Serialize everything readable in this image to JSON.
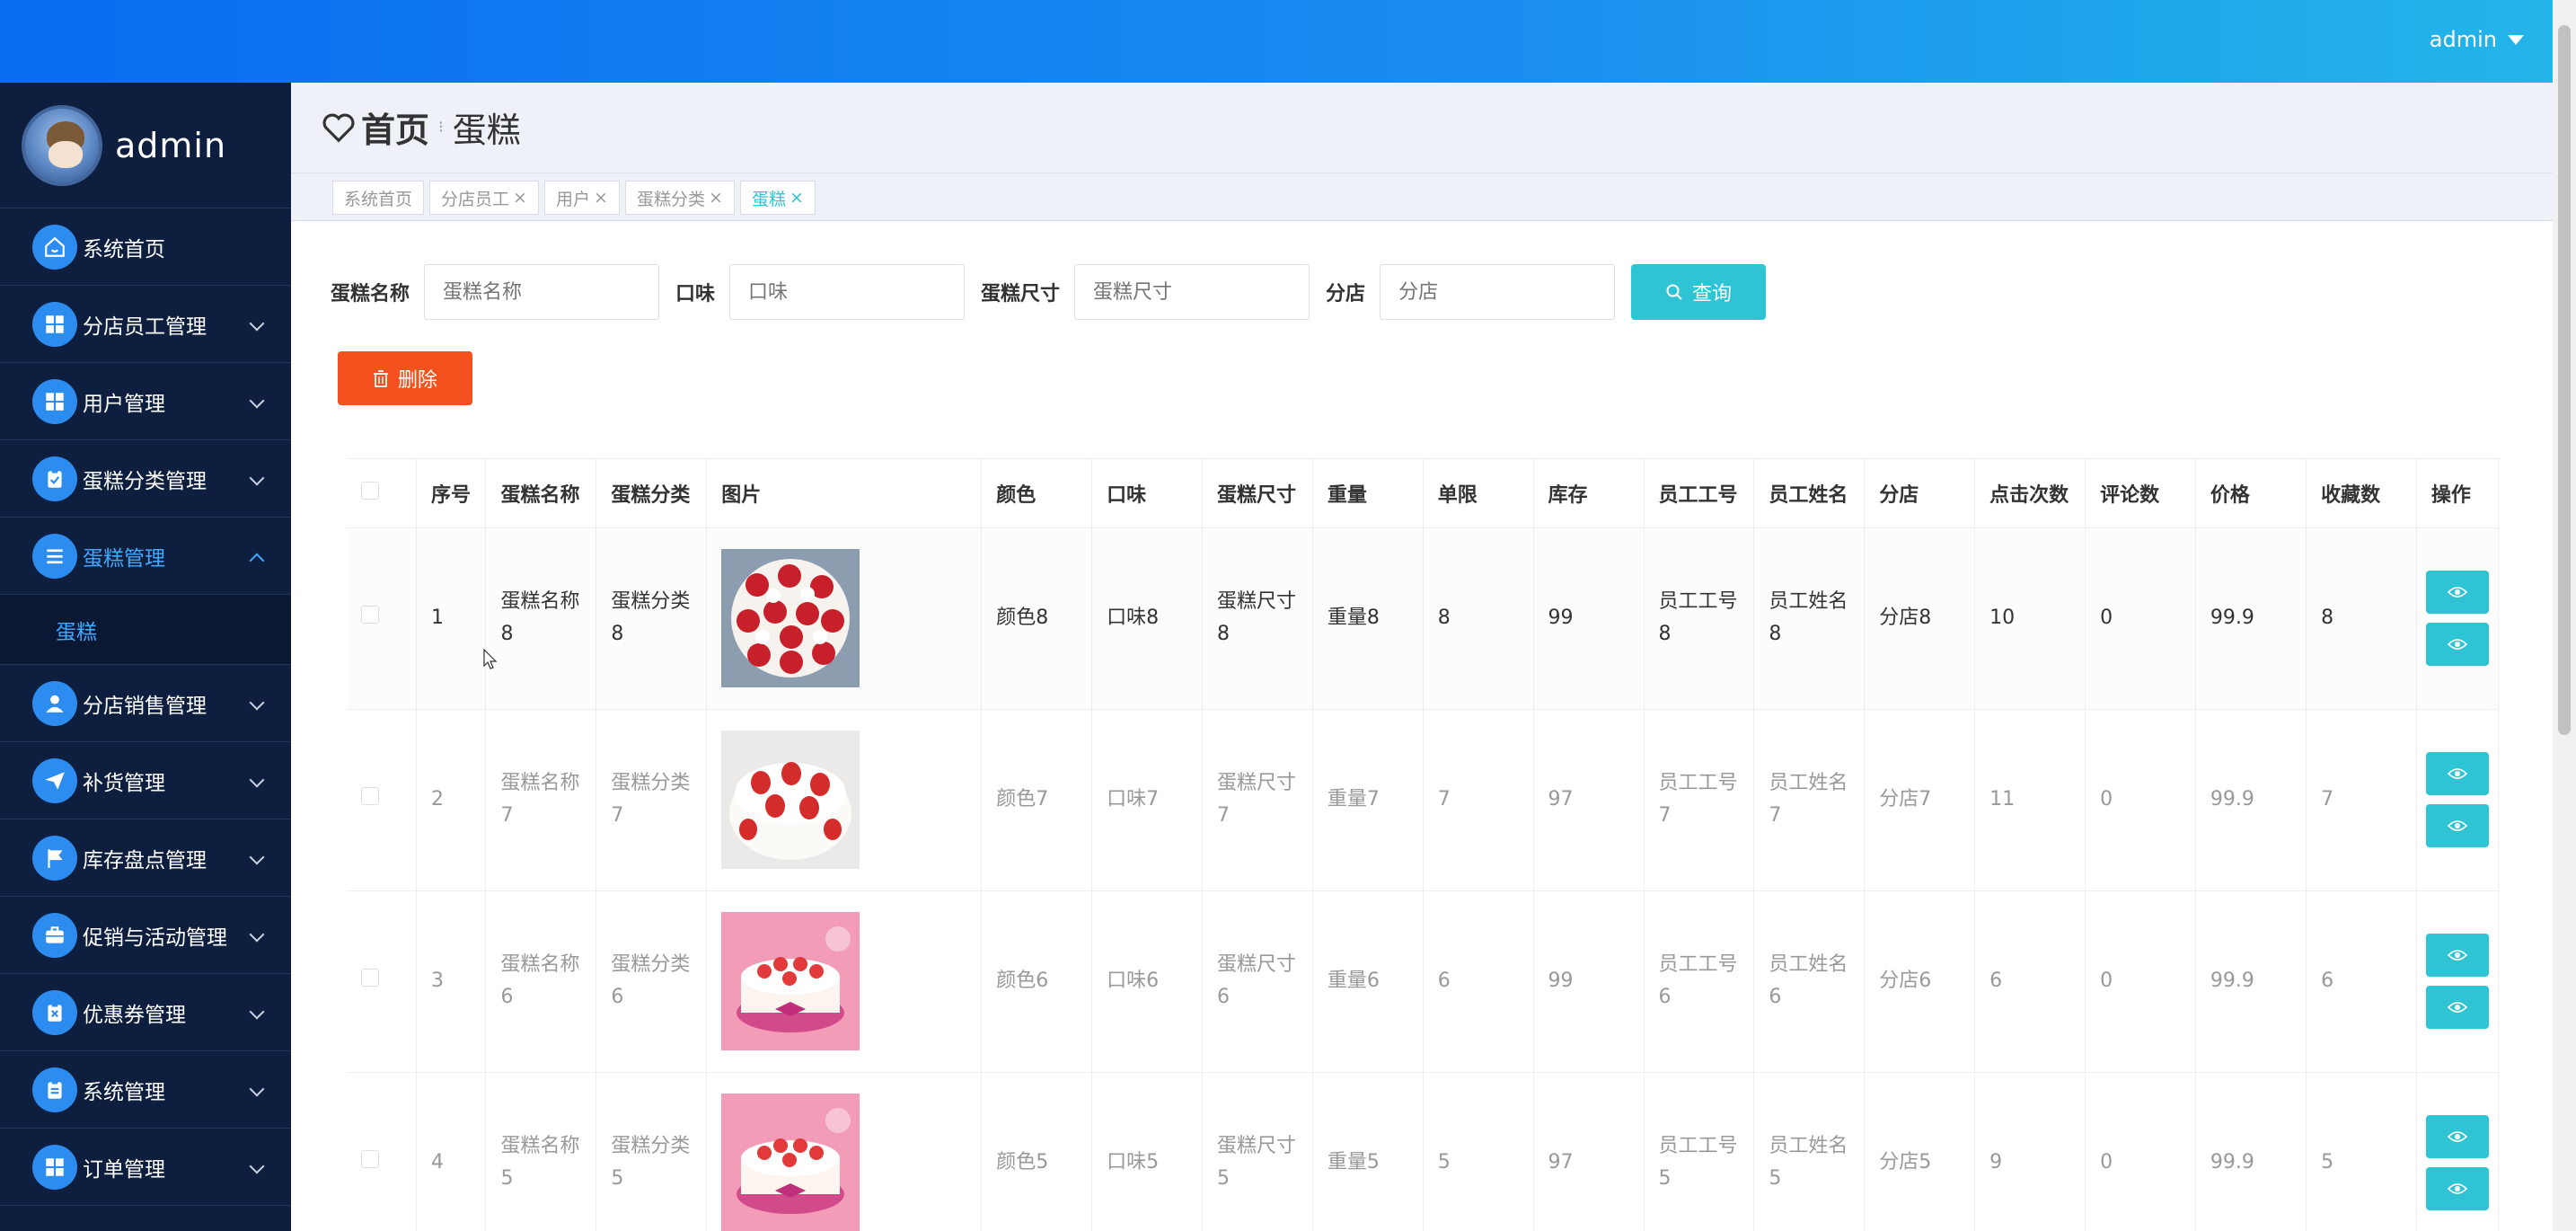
{
  "topbar": {
    "username": "admin"
  },
  "sidebar": {
    "profile_name": "admin",
    "items": [
      {
        "label": "系统首页",
        "icon": "home-icon",
        "expandable": false
      },
      {
        "label": "分店员工管理",
        "icon": "grid-icon",
        "expandable": true
      },
      {
        "label": "用户管理",
        "icon": "grid-icon",
        "expandable": true
      },
      {
        "label": "蛋糕分类管理",
        "icon": "clipboard-check-icon",
        "expandable": true
      },
      {
        "label": "蛋糕管理",
        "icon": "list-icon",
        "expandable": true,
        "active": true
      },
      {
        "label": "分店销售管理",
        "icon": "person-icon",
        "expandable": true
      },
      {
        "label": "补货管理",
        "icon": "paper-plane-icon",
        "expandable": true
      },
      {
        "label": "库存盘点管理",
        "icon": "flag-icon",
        "expandable": true
      },
      {
        "label": "促销与活动管理",
        "icon": "briefcase-icon",
        "expandable": true
      },
      {
        "label": "优惠券管理",
        "icon": "clipboard-x-icon",
        "expandable": true
      },
      {
        "label": "系统管理",
        "icon": "clipboard-icon",
        "expandable": true
      },
      {
        "label": "订单管理",
        "icon": "grid-icon",
        "expandable": true
      }
    ],
    "submenu": {
      "label": "蛋糕"
    }
  },
  "breadcrumb": {
    "home": "首页",
    "current": "蛋糕"
  },
  "tags": [
    {
      "label": "系统首页",
      "closable": false
    },
    {
      "label": "分店员工",
      "closable": true
    },
    {
      "label": "用户",
      "closable": true
    },
    {
      "label": "蛋糕分类",
      "closable": true
    },
    {
      "label": "蛋糕",
      "closable": true,
      "active": true
    }
  ],
  "search": {
    "fields": [
      {
        "label": "蛋糕名称",
        "placeholder": "蛋糕名称"
      },
      {
        "label": "口味",
        "placeholder": "口味"
      },
      {
        "label": "蛋糕尺寸",
        "placeholder": "蛋糕尺寸"
      },
      {
        "label": "分店",
        "placeholder": "分店"
      }
    ],
    "query_label": "查询"
  },
  "actions": {
    "delete_label": "删除"
  },
  "table": {
    "headers": [
      "序号",
      "蛋糕名称",
      "蛋糕分类",
      "图片",
      "颜色",
      "口味",
      "蛋糕尺寸",
      "重量",
      "单限",
      "库存",
      "员工工号",
      "员工姓名",
      "分店",
      "点击次数",
      "评论数",
      "价格",
      "收藏数",
      "操作"
    ],
    "rows": [
      {
        "cells": [
          "1",
          "蛋糕名称8",
          "蛋糕分类8",
          "",
          "颜色8",
          "口味8",
          "蛋糕尺寸8",
          "重量8",
          "8",
          "99",
          "员工工号8",
          "员工姓名8",
          "分店8",
          "10",
          "0",
          "99.9",
          "8"
        ],
        "image": "cake-strawberry-cream-top"
      },
      {
        "cells": [
          "2",
          "蛋糕名称7",
          "蛋糕分类7",
          "",
          "颜色7",
          "口味7",
          "蛋糕尺寸7",
          "重量7",
          "7",
          "97",
          "员工工号7",
          "员工姓名7",
          "分店7",
          "11",
          "0",
          "99.9",
          "7"
        ],
        "image": "cake-strawberry-cream-side"
      },
      {
        "cells": [
          "3",
          "蛋糕名称6",
          "蛋糕分类6",
          "",
          "颜色6",
          "口味6",
          "蛋糕尺寸6",
          "重量6",
          "6",
          "99",
          "员工工号6",
          "员工姓名6",
          "分店6",
          "6",
          "0",
          "99.9",
          "6"
        ],
        "image": "cake-pink-ribbon"
      },
      {
        "cells": [
          "4",
          "蛋糕名称5",
          "蛋糕分类5",
          "",
          "颜色5",
          "口味5",
          "蛋糕尺寸5",
          "重量5",
          "5",
          "97",
          "员工工号5",
          "员工姓名5",
          "分店5",
          "9",
          "0",
          "99.9",
          "5"
        ],
        "image": "cake-pink-ribbon"
      }
    ]
  },
  "colors": {
    "accent": "#2ec4d3",
    "danger": "#f4511e",
    "sidebar_bg": "#0e1e3e",
    "menu_active": "#3fa9ff"
  }
}
